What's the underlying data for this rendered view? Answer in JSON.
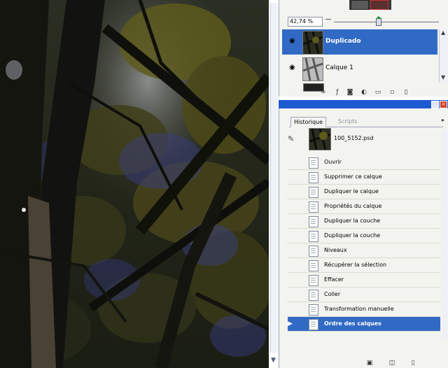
{
  "layers_panel": {
    "zoom_value": "42,74 %",
    "zoom_slider_fraction": 0.42,
    "layers": [
      {
        "name": "Duplicado",
        "visible": true,
        "selected": true
      },
      {
        "name": "Calque 1",
        "visible": true,
        "selected": false
      }
    ],
    "toolbar_icons": [
      "link-icon",
      "layer-style-icon",
      "layer-mask-icon",
      "adjustment-layer-icon",
      "new-group-icon",
      "new-layer-icon",
      "trash-icon"
    ]
  },
  "history_panel": {
    "tabs": [
      {
        "label": "Historique",
        "active": true
      },
      {
        "label": "Scripts",
        "active": false
      }
    ],
    "snapshot": {
      "filename": "100_5152.psd"
    },
    "steps": [
      {
        "label": "Ouvrir",
        "active": false
      },
      {
        "label": "Supprimer ce calque",
        "active": false
      },
      {
        "label": "Dupliquer le calque",
        "active": false
      },
      {
        "label": "Propriétés du calque",
        "active": false
      },
      {
        "label": "Dupliquer la couche",
        "active": false
      },
      {
        "label": "Dupliquer la couche",
        "active": false
      },
      {
        "label": "Niveaux",
        "active": false
      },
      {
        "label": "Récupérer la sélection",
        "active": false
      },
      {
        "label": "Effacer",
        "active": false
      },
      {
        "label": "Coller",
        "active": false
      },
      {
        "label": "Transformation manuelle",
        "active": false
      },
      {
        "label": "Ordre des calques",
        "active": true
      }
    ],
    "toolbar_icons": [
      "new-document-from-state-icon",
      "new-snapshot-icon",
      "trash-icon"
    ]
  },
  "colors": {
    "selection": "#316ac5",
    "title_bar": "#1c5ad2",
    "panel_bg": "#f3f3ef"
  }
}
